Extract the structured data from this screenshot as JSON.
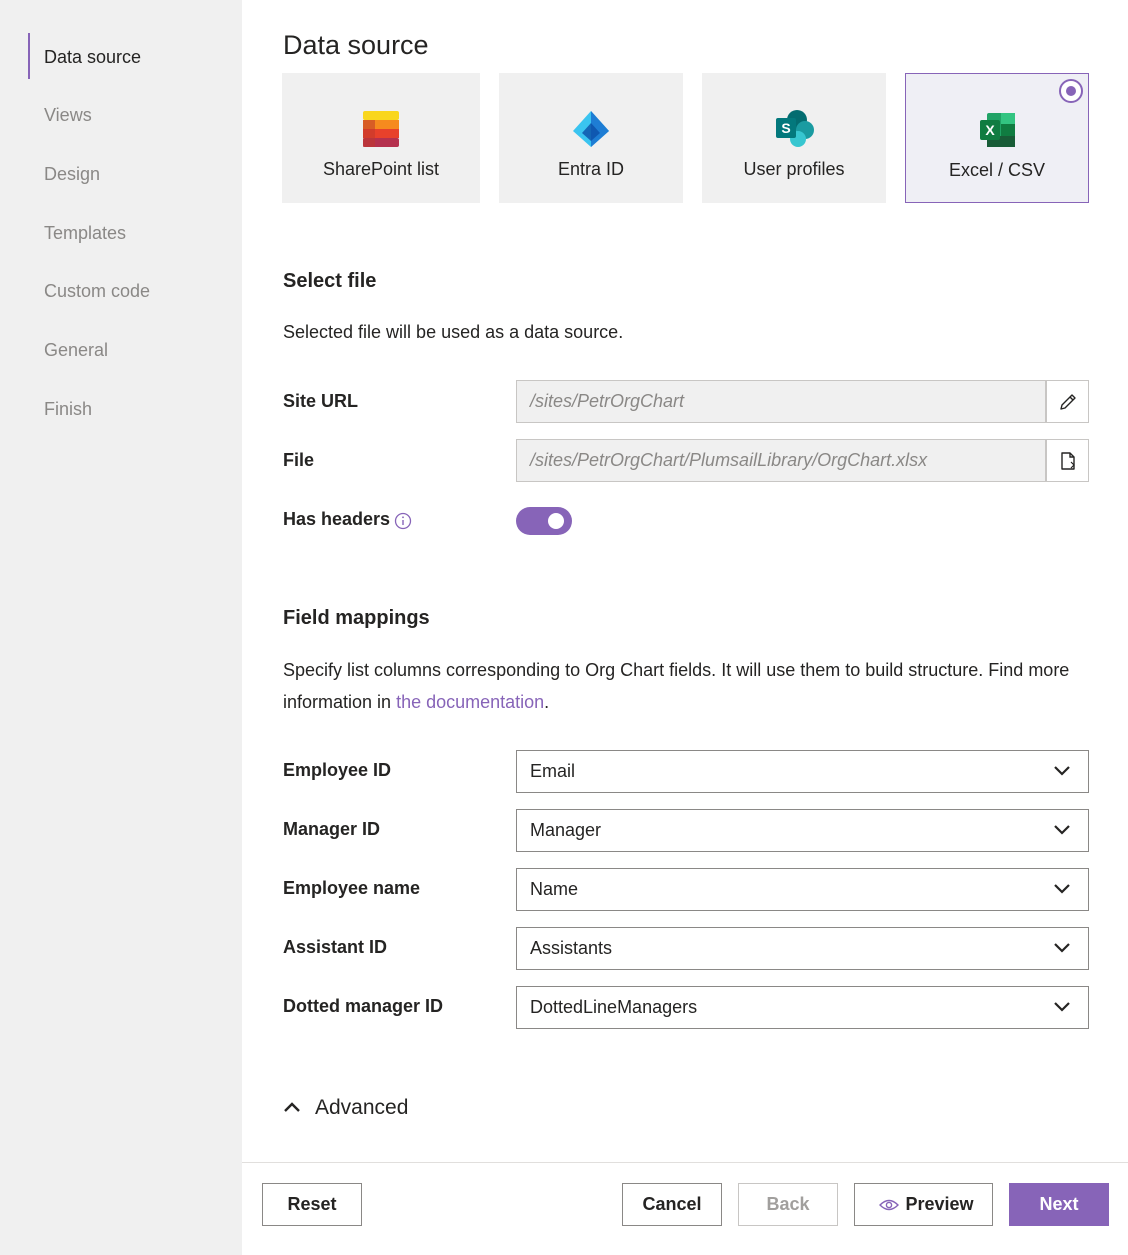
{
  "sidebar": {
    "items": [
      {
        "label": "Data source",
        "active": true
      },
      {
        "label": "Views",
        "active": false
      },
      {
        "label": "Design",
        "active": false
      },
      {
        "label": "Templates",
        "active": false
      },
      {
        "label": "Custom code",
        "active": false
      },
      {
        "label": "General",
        "active": false
      },
      {
        "label": "Finish",
        "active": false
      }
    ]
  },
  "main": {
    "title": "Data source",
    "sources": [
      {
        "label": "SharePoint list",
        "icon": "sharepoint-list-icon",
        "selected": false
      },
      {
        "label": "Entra ID",
        "icon": "entra-id-icon",
        "selected": false
      },
      {
        "label": "User profiles",
        "icon": "sharepoint-icon",
        "selected": false
      },
      {
        "label": "Excel / CSV",
        "icon": "excel-icon",
        "selected": true
      }
    ],
    "select_file": {
      "title": "Select file",
      "description": "Selected file will be used as a data source.",
      "site_url_label": "Site URL",
      "site_url_value": "/sites/PetrOrgChart",
      "file_label": "File",
      "file_value": "/sites/PetrOrgChart/PlumsailLibrary/OrgChart.xlsx",
      "has_headers_label": "Has headers",
      "has_headers_value": true
    },
    "field_mappings": {
      "title": "Field mappings",
      "description_before": "Specify list columns corresponding to Org Chart fields. It will use them to build structure. Find more information in ",
      "description_link": "the documentation",
      "description_after": ".",
      "rows": [
        {
          "label": "Employee ID",
          "value": "Email"
        },
        {
          "label": "Manager ID",
          "value": "Manager"
        },
        {
          "label": "Employee name",
          "value": "Name"
        },
        {
          "label": "Assistant ID",
          "value": "Assistants"
        },
        {
          "label": "Dotted manager ID",
          "value": "DottedLineManagers"
        }
      ]
    },
    "advanced_label": "Advanced"
  },
  "footer": {
    "reset": "Reset",
    "cancel": "Cancel",
    "back": "Back",
    "preview": "Preview",
    "next": "Next"
  },
  "colors": {
    "accent": "#8764b8",
    "sidebar_bg": "#f0f0f0"
  }
}
